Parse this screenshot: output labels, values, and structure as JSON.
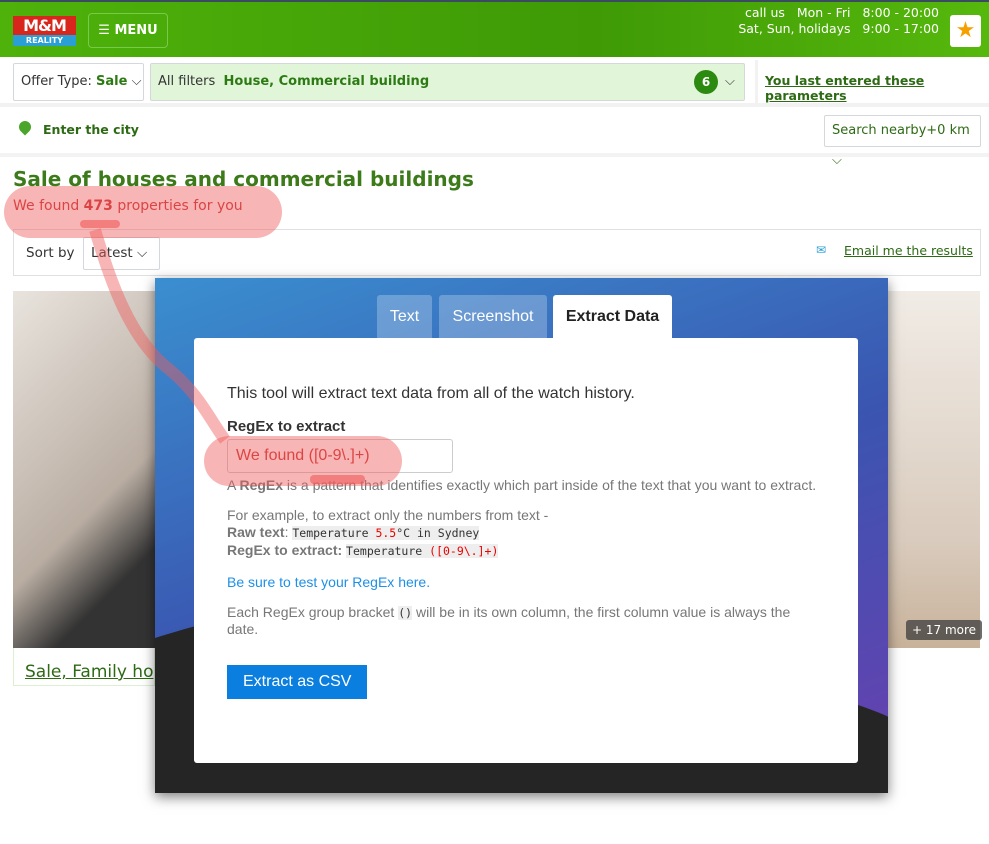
{
  "header": {
    "logo_top": "M&M",
    "logo_bottom": "REALITY",
    "menu": "MENU",
    "hours_line1": "call us   Mon - Fri   8:00 - 20:00",
    "hours_line2": "Sat, Sun, holidays   9:00 - 17:00"
  },
  "filters": {
    "offer_label": "Offer Type:",
    "offer_value": "Sale",
    "all_filters": "All filters",
    "filter_value": "House, Commercial building",
    "count": "6",
    "last_params": "You last entered these parameters",
    "city": "Enter the city",
    "nearby": "Search nearby+0 km"
  },
  "results": {
    "title": "Sale of houses and commercial buildings",
    "found_pre": "We found ",
    "found_count": "473",
    "found_post": " properties for you",
    "sort_label": "Sort by",
    "sort_value": "Latest",
    "email": "Email me the results",
    "listing_title": "Sale, Family ho",
    "more": "+ 17 more"
  },
  "modal": {
    "tabs": [
      "Text",
      "Screenshot",
      "Extract Data"
    ],
    "intro": "This tool will extract text data from all of the watch history.",
    "regex_label": "RegEx to extract",
    "regex_value": "We found ([0-9\\.]+)",
    "help_a": "A ",
    "help_b": "RegEx",
    "help_c": " is a pattern that identifies exactly which part inside of the text that you want to extract.",
    "example": "For example, to extract only the numbers from text -",
    "raw_label": "Raw text",
    "raw_1": "Temperature ",
    "raw_2": "5.5",
    "raw_3": "°C in Sydney",
    "rx_label": "RegEx to extract:",
    "rx_1": "Temperature ",
    "rx_2": "([0-9\\.]+)",
    "link": "Be sure to test your RegEx here.",
    "each_a": "Each RegEx group bracket ",
    "each_code": "()",
    "each_b": " will be in its own column, the first column value is always the date.",
    "button": "Extract as CSV"
  }
}
